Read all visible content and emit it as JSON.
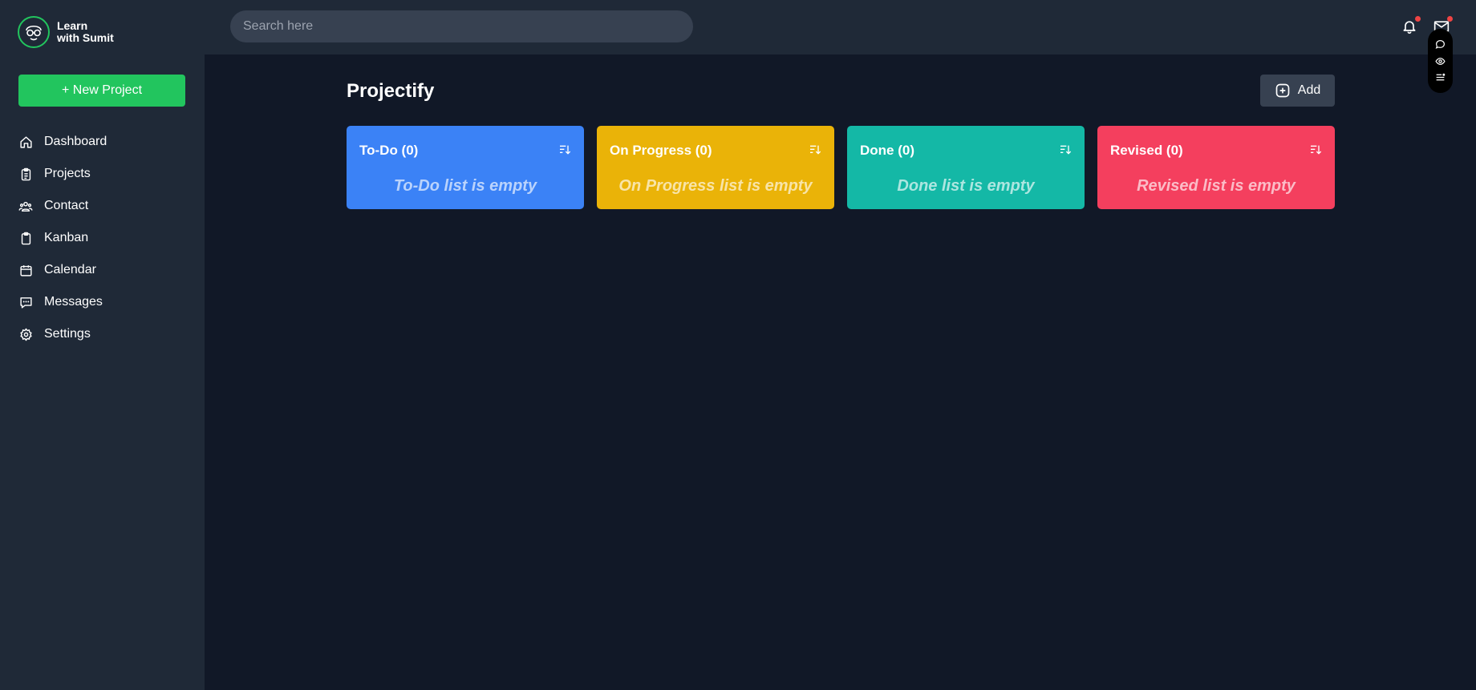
{
  "brand": {
    "name_line1": "Learn",
    "name_line2": "with Sumit",
    "accent": "#22c55e"
  },
  "sidebar": {
    "new_project_label": "+ New Project",
    "items": [
      {
        "label": "Dashboard",
        "icon": "home-icon"
      },
      {
        "label": "Projects",
        "icon": "clipboard-list-icon"
      },
      {
        "label": "Contact",
        "icon": "users-icon"
      },
      {
        "label": "Kanban",
        "icon": "clipboard-icon"
      },
      {
        "label": "Calendar",
        "icon": "calendar-icon"
      },
      {
        "label": "Messages",
        "icon": "chat-icon"
      },
      {
        "label": "Settings",
        "icon": "gear-icon"
      }
    ]
  },
  "search": {
    "placeholder": "Search here",
    "value": ""
  },
  "header_icons": {
    "notifications": "bell-icon",
    "mail": "mail-icon"
  },
  "floating_toolbar": [
    "chat-bubble-icon",
    "eye-icon",
    "list-icon"
  ],
  "main": {
    "title": "Projectify",
    "add_label": "Add",
    "columns": [
      {
        "title": "To-Do (0)",
        "empty": "To-Do list is empty",
        "color": "#3b82f6"
      },
      {
        "title": "On Progress (0)",
        "empty": "On Progress list is empty",
        "color": "#eab308"
      },
      {
        "title": "Done (0)",
        "empty": "Done list is empty",
        "color": "#14b8a6"
      },
      {
        "title": "Revised (0)",
        "empty": "Revised list is empty",
        "color": "#f43f5e"
      }
    ]
  },
  "colors": {
    "background": "#111827",
    "sidebar": "#1f2937",
    "surface": "#374151",
    "notification_dot": "#ef4444"
  }
}
